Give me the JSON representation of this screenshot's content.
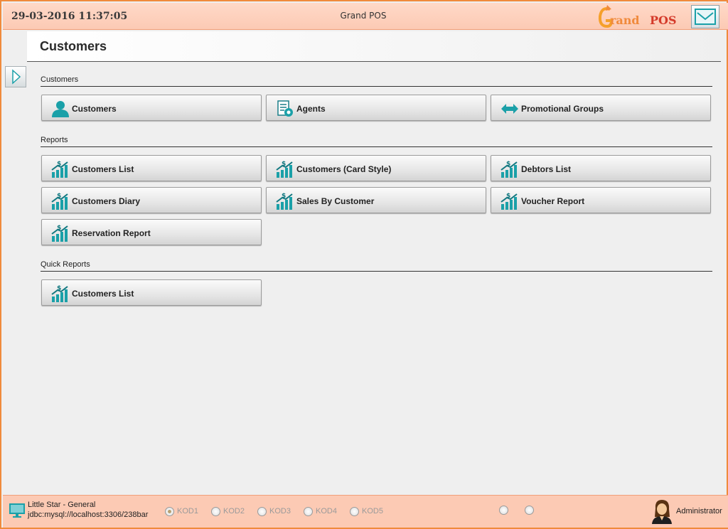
{
  "titlebar": {
    "datetime": "29-03-2016 11:37:05",
    "app_title": "Grand POS",
    "logo_text": "Grand POS",
    "menu_icon": "envelope-icon"
  },
  "page": {
    "title": "Customers"
  },
  "sections": {
    "customers": {
      "label": "Customers",
      "tiles": [
        {
          "label": "Customers",
          "icon": "person-icon"
        },
        {
          "label": "Agents",
          "icon": "agents-icon"
        },
        {
          "label": "Promotional Groups",
          "icon": "double-arrow-icon"
        }
      ]
    },
    "reports": {
      "label": "Reports",
      "tiles": [
        {
          "label": "Customers List",
          "icon": "report-chart-icon"
        },
        {
          "label": "Customers (Card Style)",
          "icon": "report-chart-icon"
        },
        {
          "label": "Debtors List",
          "icon": "report-chart-icon"
        },
        {
          "label": "Customers Diary",
          "icon": "report-chart-icon"
        },
        {
          "label": "Sales By Customer",
          "icon": "report-chart-icon"
        },
        {
          "label": "Voucher Report",
          "icon": "report-chart-icon"
        },
        {
          "label": "Reservation Report",
          "icon": "report-chart-icon"
        }
      ]
    },
    "quick_reports": {
      "label": "Quick Reports",
      "tiles": [
        {
          "label": "Customers List",
          "icon": "report-chart-icon"
        }
      ]
    }
  },
  "statusbar": {
    "connection_name": "Little Star - General",
    "connection_url": "jdbc:mysql://localhost:3306/238bar",
    "kitchen_options": [
      {
        "label": "KOD1",
        "selected": true
      },
      {
        "label": "KOD2",
        "selected": false
      },
      {
        "label": "KOD3",
        "selected": false
      },
      {
        "label": "KOD4",
        "selected": false
      },
      {
        "label": "KOD5",
        "selected": false
      }
    ],
    "user": "Administrator"
  },
  "colors": {
    "accent_orange": "#f08a3c",
    "titlebar_bg": "#fccab4",
    "icon_teal": "#1aa0a8",
    "logo_red": "#d43a2a"
  }
}
